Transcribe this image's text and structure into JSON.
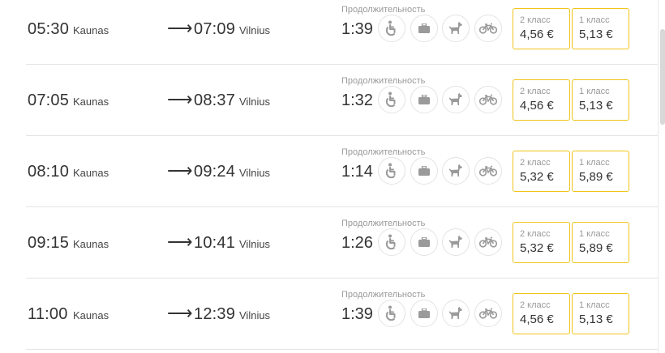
{
  "duration_label": "Продолжительность",
  "amenity_icons": [
    "wheelchair-icon",
    "luggage-icon",
    "pet-dog-icon",
    "bicycle-icon"
  ],
  "colors": {
    "fare_border": "#f0c419",
    "divider": "#e5e5e5",
    "muted_text": "#999999"
  },
  "trips": [
    {
      "departure_time": "05:30",
      "departure_city": "Kaunas",
      "arrow": "⟶",
      "arrival_time": "07:09",
      "arrival_city": "Vilnius",
      "duration": "1:39",
      "fares": [
        {
          "class_label": "2 класс",
          "price": "4,56 €"
        },
        {
          "class_label": "1 класс",
          "price": "5,13 €"
        }
      ]
    },
    {
      "departure_time": "07:05",
      "departure_city": "Kaunas",
      "arrow": "⟶",
      "arrival_time": "08:37",
      "arrival_city": "Vilnius",
      "duration": "1:32",
      "fares": [
        {
          "class_label": "2 класс",
          "price": "4,56 €"
        },
        {
          "class_label": "1 класс",
          "price": "5,13 €"
        }
      ]
    },
    {
      "departure_time": "08:10",
      "departure_city": "Kaunas",
      "arrow": "⟶",
      "arrival_time": "09:24",
      "arrival_city": "Vilnius",
      "duration": "1:14",
      "fares": [
        {
          "class_label": "2 класс",
          "price": "5,32 €"
        },
        {
          "class_label": "1 класс",
          "price": "5,89 €"
        }
      ]
    },
    {
      "departure_time": "09:15",
      "departure_city": "Kaunas",
      "arrow": "⟶",
      "arrival_time": "10:41",
      "arrival_city": "Vilnius",
      "duration": "1:26",
      "fares": [
        {
          "class_label": "2 класс",
          "price": "5,32 €"
        },
        {
          "class_label": "1 класс",
          "price": "5,89 €"
        }
      ]
    },
    {
      "departure_time": "11:00",
      "departure_city": "Kaunas",
      "arrow": "⟶",
      "arrival_time": "12:39",
      "arrival_city": "Vilnius",
      "duration": "1:39",
      "fares": [
        {
          "class_label": "2 класс",
          "price": "4,56 €"
        },
        {
          "class_label": "1 класс",
          "price": "5,13 €"
        }
      ]
    }
  ]
}
